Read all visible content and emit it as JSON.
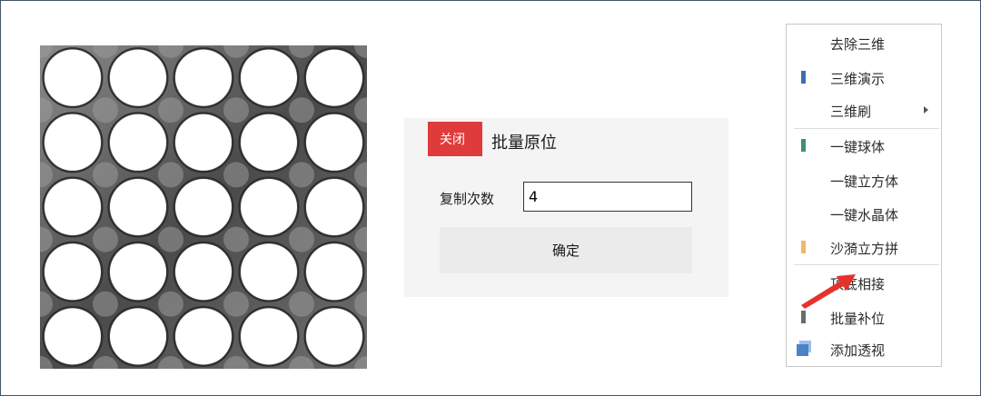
{
  "dialog": {
    "close_label": "关闭",
    "title": "批量原位",
    "count_label": "复制次数",
    "count_value": "4",
    "confirm_label": "确定"
  },
  "context_menu": {
    "items": [
      {
        "label": "去除三维",
        "mark": ""
      },
      {
        "label": "三维演示",
        "mark": "#3d6fb0"
      },
      {
        "label": "三维刷",
        "mark": "",
        "submenu": true
      },
      {
        "label": "一键球体",
        "mark": "#3f8f6a"
      },
      {
        "label": "一键立方体",
        "mark": ""
      },
      {
        "label": "一键水晶体",
        "mark": ""
      },
      {
        "label": "沙漪立方拼",
        "mark": "#f0b86a"
      },
      {
        "label": "顶底相接",
        "mark": ""
      },
      {
        "label": "批量补位",
        "mark": "#6b6b6b"
      },
      {
        "label": "添加透视",
        "icon": "stacked-cubes-icon"
      }
    ]
  },
  "colors": {
    "close_button": "#e03b3b",
    "annotation_arrow": "#e5322d",
    "lattice_shade": "#5a5a5a"
  },
  "icons": [
    "submenu-arrow-icon",
    "stacked-cubes-icon",
    "red-pointer-arrow-icon"
  ]
}
